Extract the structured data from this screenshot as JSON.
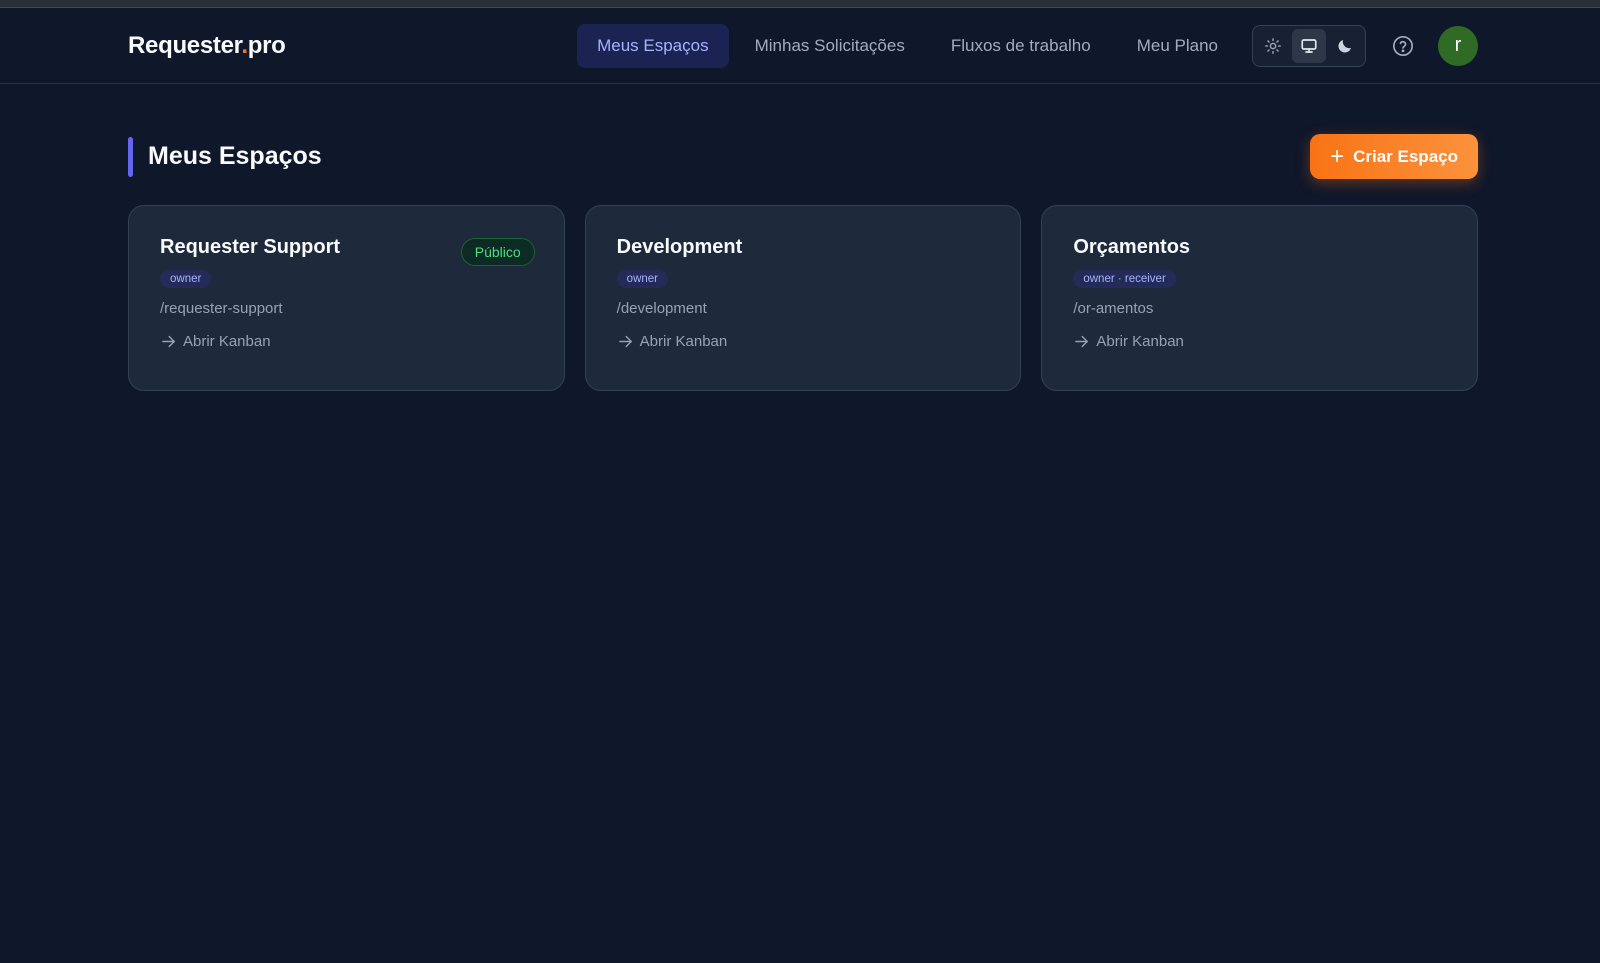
{
  "app": {
    "logo_name": "Requester",
    "logo_dot": ".",
    "logo_tld": "pro"
  },
  "nav": {
    "items": [
      {
        "label": "Meus Espaços",
        "active": true
      },
      {
        "label": "Minhas Solicitações",
        "active": false
      },
      {
        "label": "Fluxos de trabalho",
        "active": false
      },
      {
        "label": "Meu Plano",
        "active": false
      }
    ],
    "theme_options": [
      "sun-icon",
      "monitor-icon",
      "moon-icon"
    ],
    "theme_selected": "monitor-icon",
    "help_icon": "help-circle-icon",
    "avatar_initial": "r"
  },
  "main": {
    "title": "Meus Espaços",
    "create_button": {
      "icon": "plus-icon",
      "label": "Criar Espaço"
    }
  },
  "spaces": [
    {
      "name": "Requester Support",
      "badge": "Público",
      "roles": "owner",
      "slug": "/requester-support",
      "link": "Abrir Kanban"
    },
    {
      "name": "Development",
      "badge": "",
      "roles": "owner",
      "slug": "/development",
      "link": "Abrir Kanban"
    },
    {
      "name": "Orçamentos",
      "badge": "",
      "roles": "owner · receiver",
      "slug": "/or-amentos",
      "link": "Abrir Kanban"
    }
  ],
  "colors": {
    "background": "#0f172a",
    "card": "#1e293b",
    "accent": "#6366f1",
    "brand_orange": "#f97316",
    "public_badge": "#4ade80",
    "avatar": "#2f6b25"
  }
}
